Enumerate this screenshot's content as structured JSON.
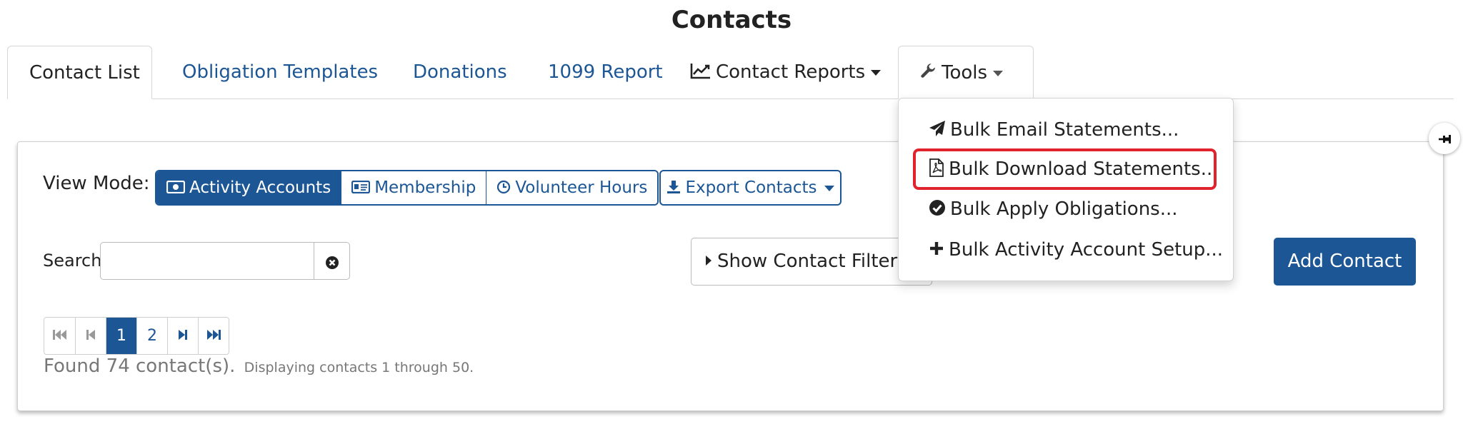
{
  "page": {
    "title": "Contacts"
  },
  "tabs": {
    "contact_list": "Contact List",
    "obligation_templates": "Obligation Templates",
    "donations": "Donations",
    "report_1099": "1099 Report",
    "contact_reports": "Contact Reports",
    "tools": "Tools"
  },
  "tools_menu": {
    "items": [
      {
        "label": "Bulk Email Statements...",
        "icon": "paper-plane-icon"
      },
      {
        "label": "Bulk Download Statements...",
        "icon": "file-pdf-icon",
        "highlighted": true
      },
      {
        "label": "Bulk Apply Obligations...",
        "icon": "check-circle-icon"
      },
      {
        "label": "Bulk Activity Account Setup...",
        "icon": "plus-icon"
      }
    ]
  },
  "view_mode": {
    "label": "View Mode:",
    "options": [
      {
        "label": "Activity Accounts",
        "icon": "money-icon",
        "active": true
      },
      {
        "label": "Membership",
        "icon": "id-card-icon",
        "active": false
      },
      {
        "label": "Volunteer Hours",
        "icon": "clock-icon",
        "active": false
      }
    ]
  },
  "export": {
    "label": "Export Contacts"
  },
  "search": {
    "label": "Search",
    "value": "",
    "placeholder": ""
  },
  "filters": {
    "label": "Show Contact Filters"
  },
  "add_contact": {
    "label": "Add Contact"
  },
  "pagination": {
    "pages": [
      "1",
      "2"
    ],
    "current": "1"
  },
  "results": {
    "found": "Found 74 contact(s).",
    "displaying": "Displaying contacts 1 through 50."
  },
  "colors": {
    "primary": "#1c5694",
    "highlight": "#e0232c"
  }
}
